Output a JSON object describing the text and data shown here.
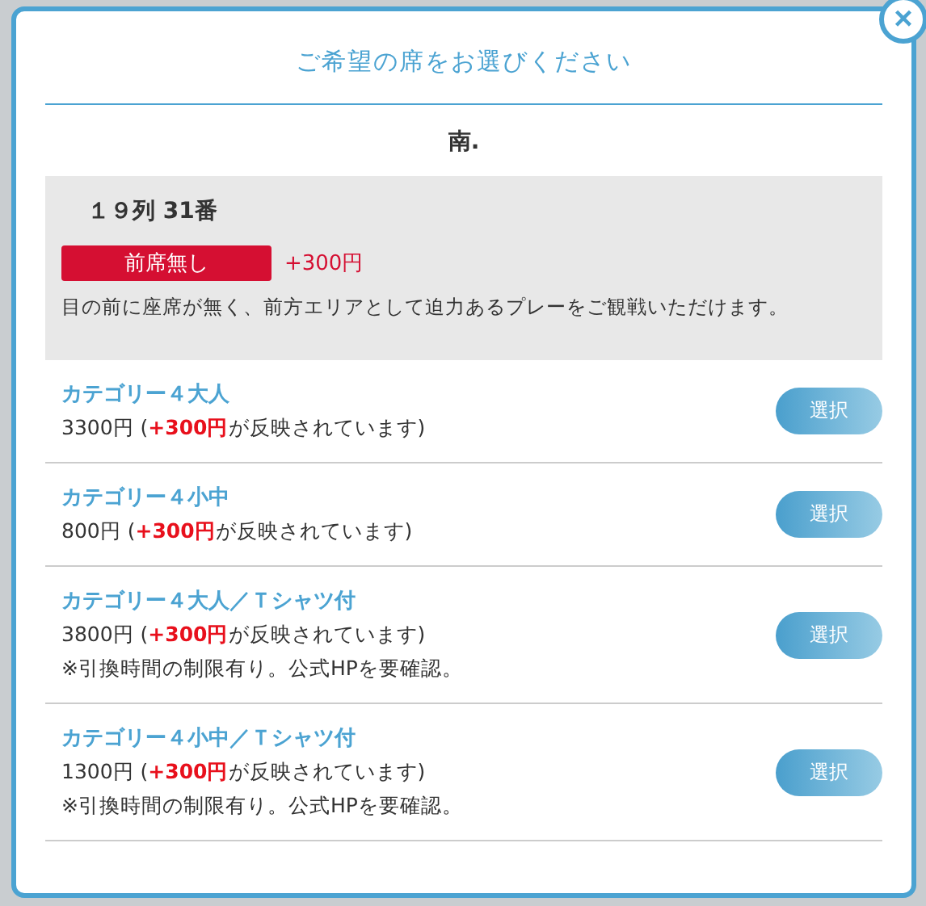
{
  "modal": {
    "title": "ご希望の席をお選びください",
    "close": "×"
  },
  "section": "南.",
  "seat": {
    "label": "１９列 31番",
    "tag": "前席無し",
    "surcharge": "+300円",
    "description": "目の前に座席が無く、前方エリアとして迫力あるプレーをご観戦いただけます。"
  },
  "options": [
    {
      "name": "カテゴリー４大人",
      "price": "3300円 (**+300円**が反映されています)",
      "button": "選択"
    },
    {
      "name": "カテゴリー４小中",
      "price": "800円 (**+300円**が反映されています)",
      "button": "選択"
    },
    {
      "name": "カテゴリー４大人／Ｔシャツ付",
      "price": "3800円 (**+300円**が反映されています)",
      "note": "※引換時間の制限有り。公式HPを要確認。",
      "button": "選択"
    },
    {
      "name": "カテゴリー４小中／Ｔシャツ付",
      "price": "1300円 (**+300円**が反映されています)",
      "note": "※引換時間の制限有り。公式HPを要確認。",
      "button": "選択"
    }
  ]
}
